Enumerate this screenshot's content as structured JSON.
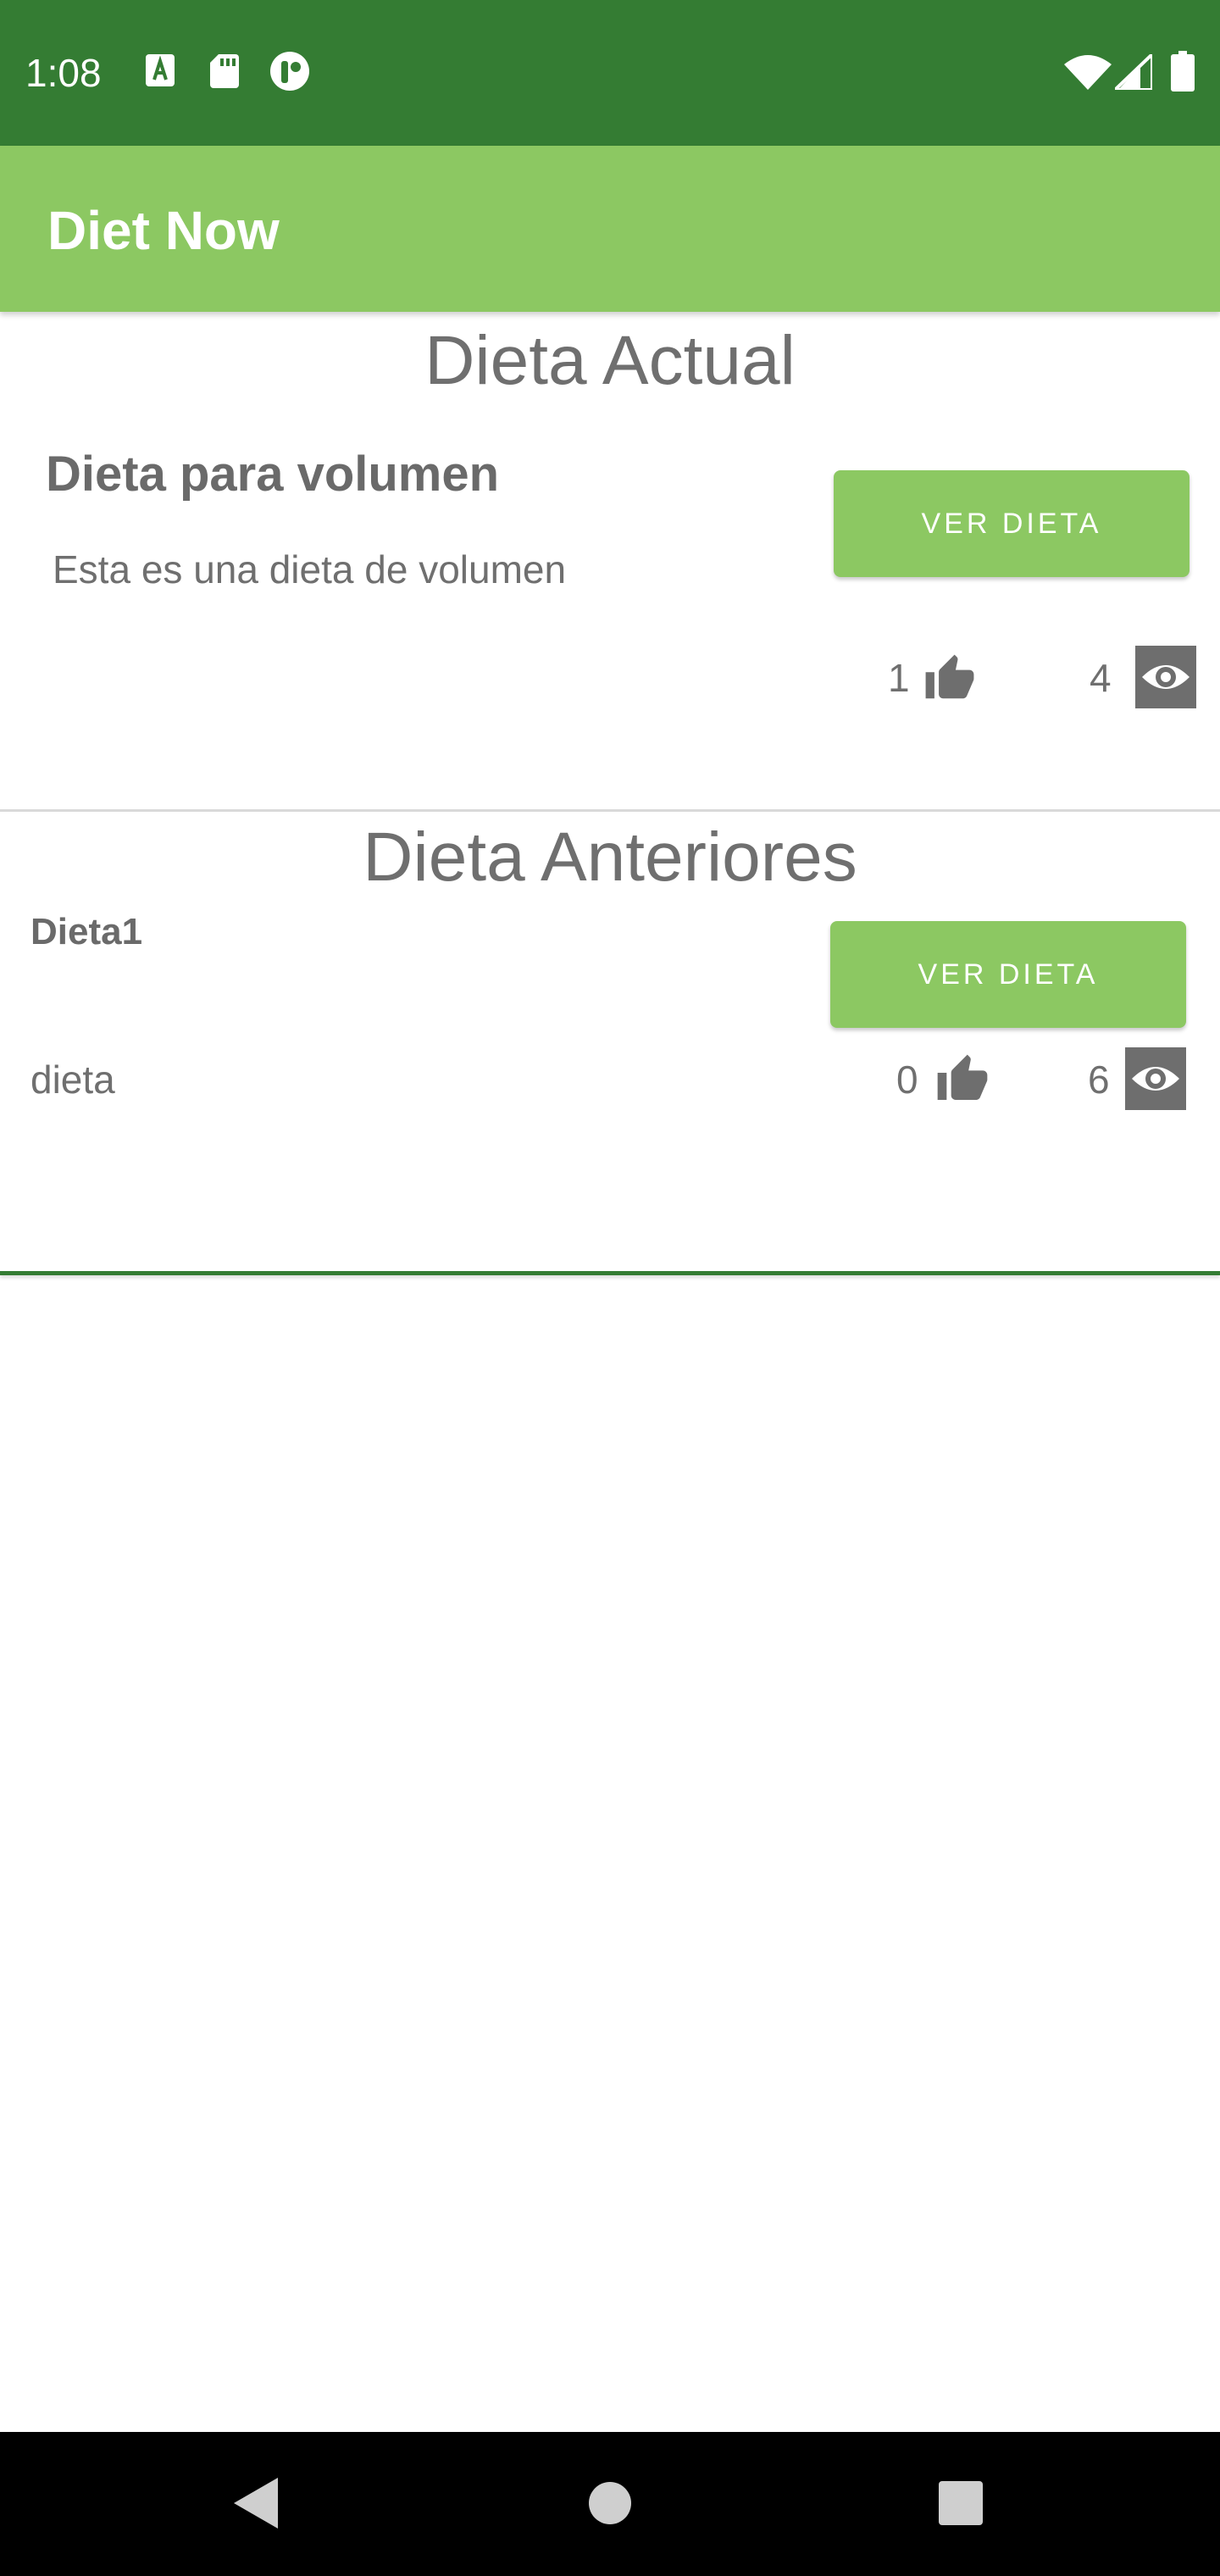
{
  "status_bar": {
    "time": "1:08",
    "icons": [
      "a-box-icon",
      "sd-card-icon",
      "app-circle-icon",
      "wifi-icon",
      "signal-icon",
      "battery-icon"
    ]
  },
  "app_bar": {
    "title": "Diet Now"
  },
  "current_section": {
    "title": "Dieta Actual",
    "diet": {
      "name": "Dieta para volumen",
      "description": "Esta es una dieta de volumen",
      "button_label": "VER DIETA",
      "likes": "1",
      "views": "4"
    }
  },
  "previous_section": {
    "title": "Dieta Anteriores",
    "diets": [
      {
        "name": "Dieta1",
        "description": "dieta",
        "button_label": "VER DIETA",
        "likes": "0",
        "views": "6"
      }
    ]
  },
  "nav_bar": {
    "icons": [
      "back-icon",
      "home-icon",
      "recents-icon"
    ]
  },
  "colors": {
    "status_bar": "#347C33",
    "app_bar": "#8CC862",
    "button": "#8CC862",
    "text_gray": "#6f6f6f",
    "icon_gray": "#6e6e6e"
  }
}
